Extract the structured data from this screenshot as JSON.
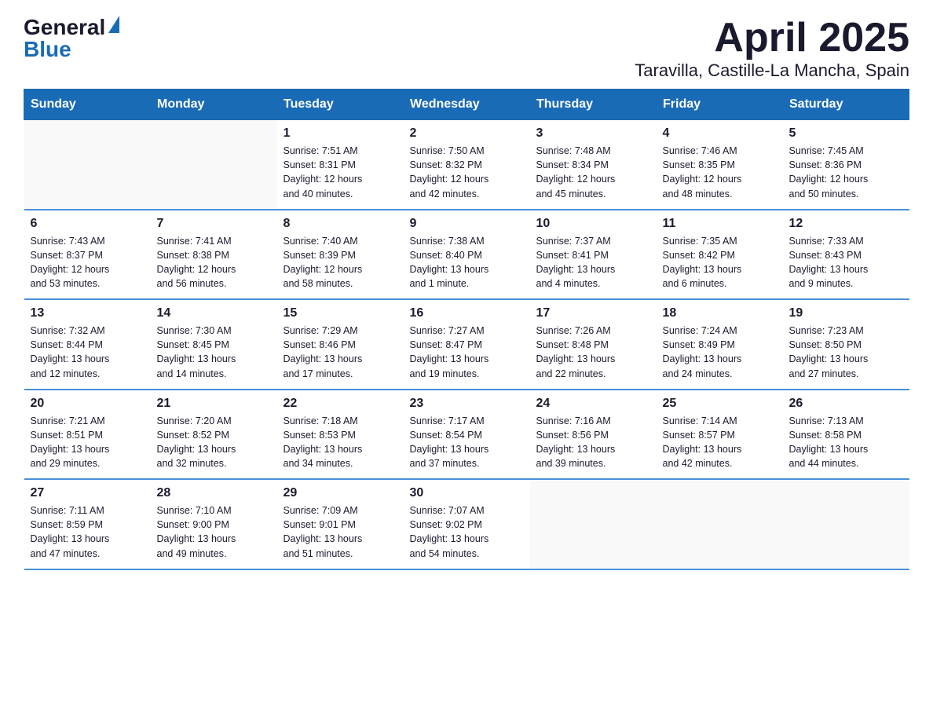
{
  "header": {
    "logo_general": "General",
    "logo_blue": "Blue",
    "month_title": "April 2025",
    "location": "Taravilla, Castille-La Mancha, Spain"
  },
  "weekdays": [
    "Sunday",
    "Monday",
    "Tuesday",
    "Wednesday",
    "Thursday",
    "Friday",
    "Saturday"
  ],
  "weeks": [
    [
      {
        "day": "",
        "info": ""
      },
      {
        "day": "",
        "info": ""
      },
      {
        "day": "1",
        "info": "Sunrise: 7:51 AM\nSunset: 8:31 PM\nDaylight: 12 hours\nand 40 minutes."
      },
      {
        "day": "2",
        "info": "Sunrise: 7:50 AM\nSunset: 8:32 PM\nDaylight: 12 hours\nand 42 minutes."
      },
      {
        "day": "3",
        "info": "Sunrise: 7:48 AM\nSunset: 8:34 PM\nDaylight: 12 hours\nand 45 minutes."
      },
      {
        "day": "4",
        "info": "Sunrise: 7:46 AM\nSunset: 8:35 PM\nDaylight: 12 hours\nand 48 minutes."
      },
      {
        "day": "5",
        "info": "Sunrise: 7:45 AM\nSunset: 8:36 PM\nDaylight: 12 hours\nand 50 minutes."
      }
    ],
    [
      {
        "day": "6",
        "info": "Sunrise: 7:43 AM\nSunset: 8:37 PM\nDaylight: 12 hours\nand 53 minutes."
      },
      {
        "day": "7",
        "info": "Sunrise: 7:41 AM\nSunset: 8:38 PM\nDaylight: 12 hours\nand 56 minutes."
      },
      {
        "day": "8",
        "info": "Sunrise: 7:40 AM\nSunset: 8:39 PM\nDaylight: 12 hours\nand 58 minutes."
      },
      {
        "day": "9",
        "info": "Sunrise: 7:38 AM\nSunset: 8:40 PM\nDaylight: 13 hours\nand 1 minute."
      },
      {
        "day": "10",
        "info": "Sunrise: 7:37 AM\nSunset: 8:41 PM\nDaylight: 13 hours\nand 4 minutes."
      },
      {
        "day": "11",
        "info": "Sunrise: 7:35 AM\nSunset: 8:42 PM\nDaylight: 13 hours\nand 6 minutes."
      },
      {
        "day": "12",
        "info": "Sunrise: 7:33 AM\nSunset: 8:43 PM\nDaylight: 13 hours\nand 9 minutes."
      }
    ],
    [
      {
        "day": "13",
        "info": "Sunrise: 7:32 AM\nSunset: 8:44 PM\nDaylight: 13 hours\nand 12 minutes."
      },
      {
        "day": "14",
        "info": "Sunrise: 7:30 AM\nSunset: 8:45 PM\nDaylight: 13 hours\nand 14 minutes."
      },
      {
        "day": "15",
        "info": "Sunrise: 7:29 AM\nSunset: 8:46 PM\nDaylight: 13 hours\nand 17 minutes."
      },
      {
        "day": "16",
        "info": "Sunrise: 7:27 AM\nSunset: 8:47 PM\nDaylight: 13 hours\nand 19 minutes."
      },
      {
        "day": "17",
        "info": "Sunrise: 7:26 AM\nSunset: 8:48 PM\nDaylight: 13 hours\nand 22 minutes."
      },
      {
        "day": "18",
        "info": "Sunrise: 7:24 AM\nSunset: 8:49 PM\nDaylight: 13 hours\nand 24 minutes."
      },
      {
        "day": "19",
        "info": "Sunrise: 7:23 AM\nSunset: 8:50 PM\nDaylight: 13 hours\nand 27 minutes."
      }
    ],
    [
      {
        "day": "20",
        "info": "Sunrise: 7:21 AM\nSunset: 8:51 PM\nDaylight: 13 hours\nand 29 minutes."
      },
      {
        "day": "21",
        "info": "Sunrise: 7:20 AM\nSunset: 8:52 PM\nDaylight: 13 hours\nand 32 minutes."
      },
      {
        "day": "22",
        "info": "Sunrise: 7:18 AM\nSunset: 8:53 PM\nDaylight: 13 hours\nand 34 minutes."
      },
      {
        "day": "23",
        "info": "Sunrise: 7:17 AM\nSunset: 8:54 PM\nDaylight: 13 hours\nand 37 minutes."
      },
      {
        "day": "24",
        "info": "Sunrise: 7:16 AM\nSunset: 8:56 PM\nDaylight: 13 hours\nand 39 minutes."
      },
      {
        "day": "25",
        "info": "Sunrise: 7:14 AM\nSunset: 8:57 PM\nDaylight: 13 hours\nand 42 minutes."
      },
      {
        "day": "26",
        "info": "Sunrise: 7:13 AM\nSunset: 8:58 PM\nDaylight: 13 hours\nand 44 minutes."
      }
    ],
    [
      {
        "day": "27",
        "info": "Sunrise: 7:11 AM\nSunset: 8:59 PM\nDaylight: 13 hours\nand 47 minutes."
      },
      {
        "day": "28",
        "info": "Sunrise: 7:10 AM\nSunset: 9:00 PM\nDaylight: 13 hours\nand 49 minutes."
      },
      {
        "day": "29",
        "info": "Sunrise: 7:09 AM\nSunset: 9:01 PM\nDaylight: 13 hours\nand 51 minutes."
      },
      {
        "day": "30",
        "info": "Sunrise: 7:07 AM\nSunset: 9:02 PM\nDaylight: 13 hours\nand 54 minutes."
      },
      {
        "day": "",
        "info": ""
      },
      {
        "day": "",
        "info": ""
      },
      {
        "day": "",
        "info": ""
      }
    ]
  ]
}
